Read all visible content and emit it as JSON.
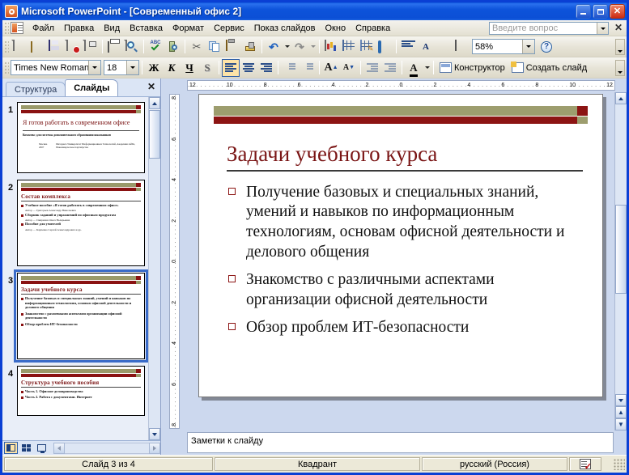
{
  "window": {
    "title": "Microsoft PowerPoint - [Современный офис 2]",
    "app_icon": "powerpoint-icon",
    "minimize_label": "_",
    "maximize_label": "□",
    "close_label": "✕"
  },
  "menu": {
    "items": [
      {
        "label": "Файл"
      },
      {
        "label": "Правка"
      },
      {
        "label": "Вид"
      },
      {
        "label": "Вставка"
      },
      {
        "label": "Формат"
      },
      {
        "label": "Сервис"
      },
      {
        "label": "Показ слайдов"
      },
      {
        "label": "Окно"
      },
      {
        "label": "Справка"
      }
    ],
    "ask_placeholder": "Введите вопрос",
    "close_label": "✕"
  },
  "standard_toolbar": {
    "buttons": [
      {
        "name": "new-icon",
        "tip": "Создать"
      },
      {
        "name": "open-icon",
        "tip": "Открыть"
      },
      {
        "name": "save-icon",
        "tip": "Сохранить"
      },
      {
        "name": "permission-icon",
        "tip": "Разрешение"
      },
      {
        "name": "email-icon",
        "tip": "Сообщение"
      },
      {
        "name": "print-icon",
        "tip": "Печать"
      },
      {
        "name": "print-preview-icon",
        "tip": "Предварительный просмотр"
      },
      {
        "name": "spelling-icon",
        "tip": "Орфография"
      },
      {
        "name": "research-icon",
        "tip": "Справочные материалы"
      },
      {
        "name": "cut-icon",
        "tip": "Вырезать"
      },
      {
        "name": "copy-icon",
        "tip": "Копировать"
      },
      {
        "name": "paste-icon",
        "tip": "Вставить"
      },
      {
        "name": "format-painter-icon",
        "tip": "Формат по образцу"
      },
      {
        "name": "undo-icon",
        "tip": "Отменить"
      },
      {
        "name": "redo-icon",
        "tip": "Вернуть"
      },
      {
        "name": "chart-icon",
        "tip": "Диаграмма"
      },
      {
        "name": "table-icon",
        "tip": "Таблица"
      },
      {
        "name": "insert-diagram-icon",
        "tip": "Добавить диаграмму"
      },
      {
        "name": "hyperlink-icon",
        "tip": "Гиперссылка"
      },
      {
        "name": "expand-all-icon",
        "tip": "Развернуть все"
      },
      {
        "name": "show-formatting-icon",
        "tip": "Показать форматирование"
      },
      {
        "name": "grid-icon",
        "tip": "Сетка"
      },
      {
        "name": "color-grayscale-icon",
        "tip": "Цвет или оттенки серого"
      }
    ],
    "zoom_value": "58%",
    "help_label": "?"
  },
  "formatting_toolbar": {
    "font_name": "Times New Roman",
    "font_size": "18",
    "bold_label": "Ж",
    "italic_label": "К",
    "underline_label": "Ч",
    "shadow_label": "S",
    "align_left": "align-left-icon",
    "align_center": "align-center-icon",
    "align_right": "align-right-icon",
    "numbering": "numbering-icon",
    "bullets": "bullets-icon",
    "increase_font": "A",
    "decrease_font": "A",
    "decrease_indent": "decrease-indent-icon",
    "increase_indent": "increase-indent-icon",
    "font_color": "A",
    "design_label": "Конструктор",
    "new_slide_label": "Создать слайд"
  },
  "left_panel": {
    "tabs": [
      {
        "label": "Структура",
        "active": false
      },
      {
        "label": "Слайды",
        "active": true
      }
    ],
    "close_label": "✕",
    "slides": [
      {
        "number": "1",
        "selected": false,
        "title": "Я готов работать в современном офисе",
        "subtitle": "Комплекс для системы дополнительного образования школьников",
        "footer_left": "Москва 2007",
        "footer_right": "Интернет-Университет Информационных Технологий, Академия АйТи, Некоммерческое партнёрство"
      },
      {
        "number": "2",
        "selected": false,
        "title": "Состав комплекса",
        "items": [
          {
            "text": "Учебное пособие «Я готов работать в современном офисе»",
            "sub": "Автор — Григорьев Александр Николаевич"
          },
          {
            "text": "Сборник заданий и упражнений по офисным продуктам",
            "sub": "Автор — Смирнова Ольга Валерьевна"
          },
          {
            "text": "Пособие для учителей",
            "sub": "Автор — Карпенко Сергей Александрович и др."
          }
        ]
      },
      {
        "number": "3",
        "selected": true,
        "title": "Задачи учебного курса",
        "items": [
          {
            "text": "Получение базовых и специальных знаний, умений и навыков по информационным технологиям, основам офисной деятельности и делового общения"
          },
          {
            "text": "Знакомство с различными аспектами организации офисной деятельности"
          },
          {
            "text": "Обзор проблем ИТ-безопасности"
          }
        ]
      },
      {
        "number": "4",
        "selected": false,
        "title": "Структура учебного пособия",
        "items": [
          {
            "text": "Часть 1. Офисное делопроизводство"
          },
          {
            "text": "Часть 2. Работа с документами. Интернет"
          }
        ]
      }
    ],
    "view_buttons": [
      {
        "name": "normal-view-button",
        "active": true
      },
      {
        "name": "slide-sorter-view-button",
        "active": false
      },
      {
        "name": "slide-show-button",
        "active": false
      }
    ]
  },
  "rulers": {
    "horizontal_ticks": [
      "12",
      "10",
      "8",
      "6",
      "4",
      "2",
      "0",
      "2",
      "4",
      "6",
      "8",
      "10",
      "12"
    ],
    "vertical_ticks": [
      "8",
      "6",
      "4",
      "2",
      "0",
      "2",
      "4",
      "6",
      "8"
    ]
  },
  "slide": {
    "title": "Задачи учебного курса",
    "bullets": [
      "Получение базовых и специальных знаний, умений и навыков по информационным технологиям, основам офисной деятельности и делового общения",
      "Знакомство с различными аспектами организации офисной деятельности",
      "Обзор проблем ИТ-безопасности"
    ],
    "colors": {
      "title_text": "#7a1515",
      "band_olive": "#9d9d6e",
      "band_red": "#8c1413",
      "bullet_mark": "#8c1413",
      "background": "#ffffff"
    }
  },
  "notes": {
    "placeholder": "Заметки к слайду"
  },
  "statusbar": {
    "slide_counter": "Слайд 3 из 4",
    "design_template": "Квадрант",
    "language": "русский (Россия)",
    "spellcheck_icon": "spellcheck-icon"
  }
}
